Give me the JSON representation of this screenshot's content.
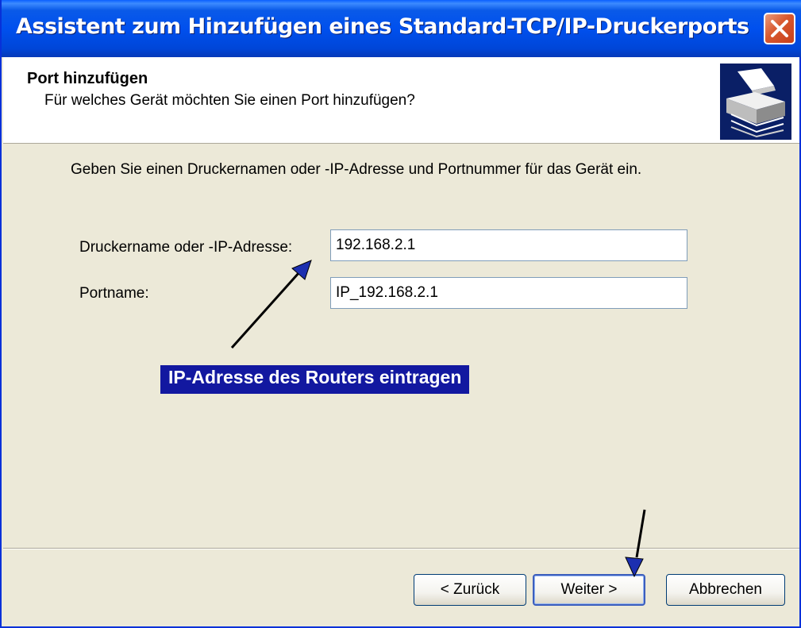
{
  "window": {
    "title": "Assistent zum Hinzufügen eines Standard-TCP/IP-Druckerports"
  },
  "header": {
    "title": "Port hinzufügen",
    "subtitle": "Für welches Gerät möchten Sie einen Port hinzufügen?",
    "icon": "printer-icon"
  },
  "body": {
    "intro": "Geben Sie einen Druckernamen oder -IP-Adresse und Portnummer für das Gerät ein.",
    "printer_label": "Druckername oder -IP-Adresse:",
    "printer_value": "192.168.2.1",
    "port_label": "Portname:",
    "port_value": "IP_192.168.2.1"
  },
  "annotation": {
    "text": "IP-Adresse des Routers eintragen",
    "color": "#1218a0"
  },
  "buttons": {
    "back": "< Zurück",
    "next": "Weiter >",
    "cancel": "Abbrechen"
  },
  "colors": {
    "titlebar": "#0050ee",
    "dialog_bg": "#ece9d8",
    "close": "#d8582e"
  }
}
